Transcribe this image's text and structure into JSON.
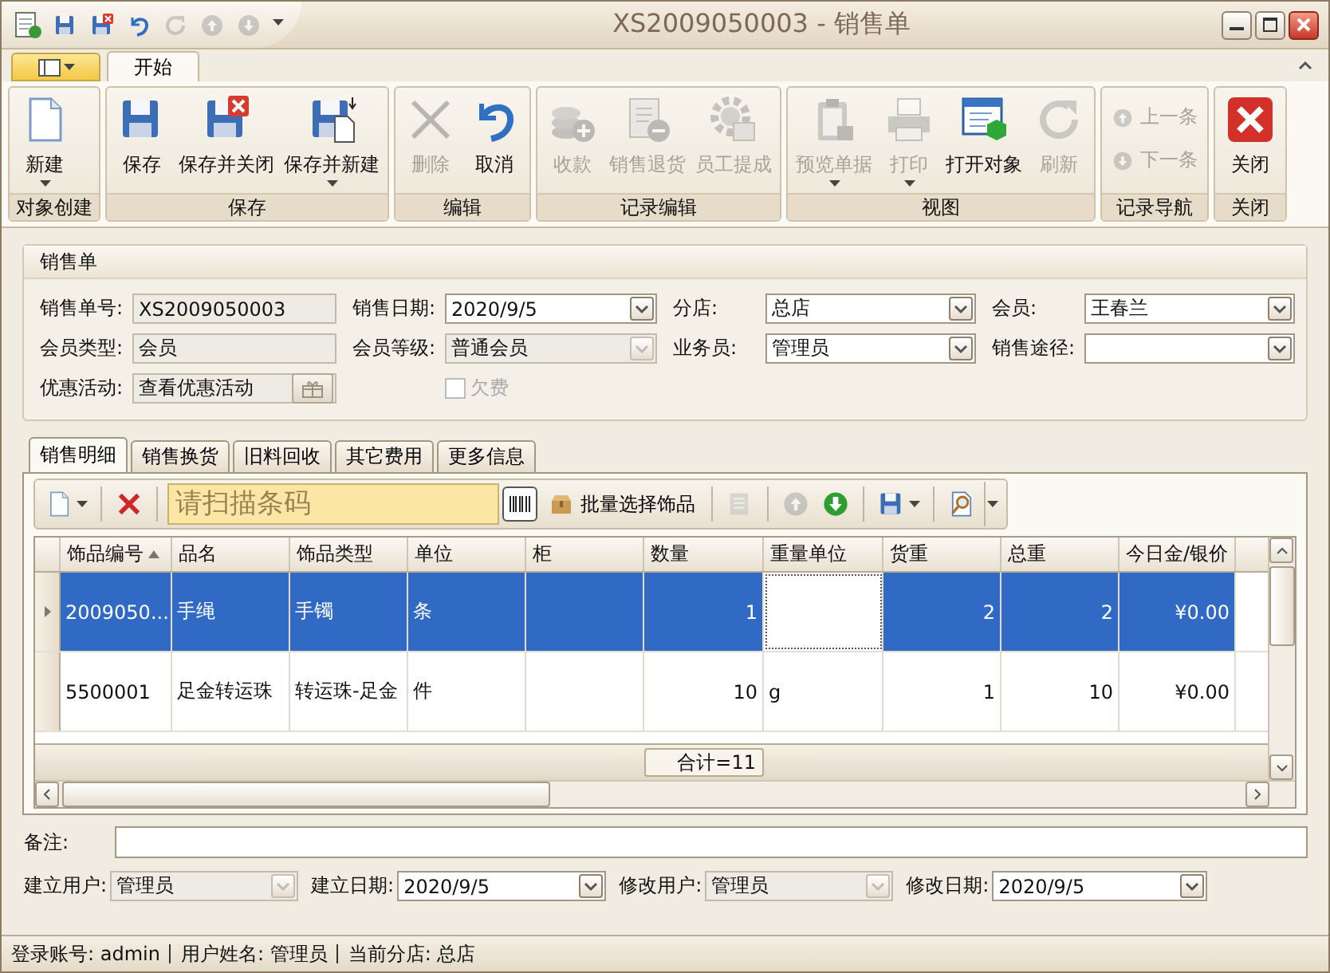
{
  "window": {
    "title": "XS2009050003 - 销售单"
  },
  "quick_access": [
    {
      "disabled": false
    },
    {
      "disabled": false
    },
    {
      "disabled": false
    },
    {
      "disabled": true
    },
    {
      "disabled": true
    },
    {
      "disabled": true
    }
  ],
  "ribbon_tabs": [
    {
      "label": "开始",
      "selected": true
    }
  ],
  "ribbon_groups": [
    {
      "label": "对象创建",
      "buttons": [
        {
          "kind": "large",
          "label": "新建",
          "disabled": false,
          "dropdown": true
        }
      ]
    },
    {
      "label": "保存",
      "buttons": [
        {
          "kind": "large",
          "label": "保存",
          "disabled": false,
          "dropdown": false
        },
        {
          "kind": "large",
          "label": "保存并关闭",
          "disabled": false,
          "dropdown": false
        },
        {
          "kind": "large",
          "label": "保存并新建",
          "disabled": false,
          "dropdown": true
        }
      ]
    },
    {
      "label": "编辑",
      "buttons": [
        {
          "kind": "large",
          "label": "删除",
          "disabled": true,
          "dropdown": false
        },
        {
          "kind": "large",
          "label": "取消",
          "disabled": false,
          "dropdown": false
        }
      ]
    },
    {
      "label": "记录编辑",
      "buttons": [
        {
          "kind": "large",
          "label": "收款",
          "disabled": true,
          "dropdown": false
        },
        {
          "kind": "large",
          "label": "销售退货",
          "disabled": true,
          "dropdown": false
        },
        {
          "kind": "large",
          "label": "员工提成",
          "disabled": true,
          "dropdown": false
        }
      ]
    },
    {
      "label": "视图",
      "buttons": [
        {
          "kind": "large",
          "label": "预览单据",
          "disabled": true,
          "dropdown": true
        },
        {
          "kind": "large",
          "label": "打印",
          "disabled": true,
          "dropdown": true
        },
        {
          "kind": "large",
          "label": "打开对象",
          "disabled": false,
          "dropdown": false
        },
        {
          "kind": "large",
          "label": "刷新",
          "disabled": true,
          "dropdown": false
        }
      ]
    },
    {
      "label": "记录导航",
      "buttons": [
        {
          "kind": "small",
          "label": "上一条",
          "disabled": true,
          "dropdown": false
        },
        {
          "kind": "small",
          "label": "下一条",
          "disabled": true,
          "dropdown": false
        }
      ]
    },
    {
      "label": "关闭",
      "buttons": [
        {
          "kind": "large",
          "label": "关闭",
          "disabled": false,
          "dropdown": false
        }
      ]
    }
  ],
  "form": {
    "title": "销售单",
    "rows": [
      [
        {
          "kind": "text",
          "label": "销售单号:",
          "value": "XS2009050003",
          "disabled": true
        },
        {
          "kind": "combo",
          "label": "销售日期:",
          "value": "2020/9/5",
          "disabled": false
        },
        {
          "kind": "combo",
          "label": "分店:",
          "value": "总店",
          "disabled": false
        },
        {
          "kind": "combo",
          "label": "会员:",
          "value": "王春兰",
          "disabled": false
        }
      ],
      [
        {
          "kind": "text",
          "label": "会员类型:",
          "value": "会员",
          "disabled": true
        },
        {
          "kind": "combo",
          "label": "会员等级:",
          "value": "普通会员",
          "disabled": true
        },
        {
          "kind": "combo",
          "label": "业务员:",
          "value": "管理员",
          "disabled": false
        },
        {
          "kind": "combo",
          "label": "销售途径:",
          "disabled": false
        }
      ],
      [
        {
          "kind": "lookup",
          "label": "优惠活动:",
          "value": "查看优惠活动",
          "disabled": true
        },
        {
          "kind": "checkbox",
          "label": "欠费",
          "checked": false,
          "disabled": true
        }
      ]
    ]
  },
  "detail_tabs": [
    {
      "label": "销售明细",
      "selected": true
    },
    {
      "label": "销售换货",
      "selected": false
    },
    {
      "label": "旧料回收",
      "selected": false
    },
    {
      "label": "其它费用",
      "selected": false
    },
    {
      "label": "更多信息",
      "selected": false
    }
  ],
  "grid_toolbar": [
    {
      "kind": "icon",
      "dropdown": true,
      "disabled": false
    },
    {
      "kind": "separator"
    },
    {
      "kind": "icon",
      "dropdown": false,
      "disabled": false
    },
    {
      "kind": "separator"
    },
    {
      "kind": "barcode",
      "placeholder": "请扫描条码"
    },
    {
      "kind": "text",
      "label": "批量选择饰品"
    },
    {
      "kind": "separator"
    },
    {
      "kind": "icon",
      "dropdown": false,
      "disabled": true
    },
    {
      "kind": "separator"
    },
    {
      "kind": "icon",
      "dropdown": false,
      "disabled": true
    },
    {
      "kind": "icon",
      "dropdown": false,
      "disabled": false
    },
    {
      "kind": "separator"
    },
    {
      "kind": "icon",
      "dropdown": true,
      "disabled": false
    },
    {
      "kind": "separator"
    },
    {
      "kind": "icon",
      "dropdown": false,
      "disabled": false
    }
  ],
  "table": {
    "columns": [
      {
        "label": "饰品编号",
        "sorted": true
      },
      {
        "label": "品名",
        "sorted": false
      },
      {
        "label": "饰品类型",
        "sorted": false
      },
      {
        "label": "单位",
        "sorted": false
      },
      {
        "label": "柜",
        "sorted": false
      },
      {
        "label": "数量",
        "sorted": false
      },
      {
        "label": "重量单位",
        "sorted": false
      },
      {
        "label": "货重",
        "sorted": false
      },
      {
        "label": "总重",
        "sorted": false
      },
      {
        "label": "今日金/银价",
        "sorted": false
      }
    ],
    "rows": [
      {
        "selected": true,
        "cells": [
          {
            "text": "2009050...",
            "focused": false
          },
          {
            "text": "手绳",
            "focused": false
          },
          {
            "text": "手镯",
            "focused": false
          },
          {
            "text": "条",
            "focused": false
          },
          {
            "focused": false
          },
          {
            "text": "1",
            "focused": false
          },
          {
            "focused": true
          },
          {
            "text": "2",
            "focused": false
          },
          {
            "text": "2",
            "focused": false
          },
          {
            "text": "¥0.00",
            "focused": false
          }
        ]
      },
      {
        "selected": false,
        "cells": [
          {
            "text": "5500001",
            "focused": false
          },
          {
            "text": "足金转运珠",
            "focused": false
          },
          {
            "text": "转运珠-足金",
            "focused": false
          },
          {
            "text": "件",
            "focused": false
          },
          {
            "focused": false
          },
          {
            "text": "10",
            "focused": false
          },
          {
            "text": "g",
            "focused": false
          },
          {
            "text": "1",
            "focused": false
          },
          {
            "text": "10",
            "focused": false
          },
          {
            "text": "¥0.00",
            "focused": false
          }
        ]
      }
    ],
    "summary": "合计=11"
  },
  "notes": {
    "label": "备注:"
  },
  "meta": [
    {
      "label": "建立用户:",
      "value": "管理员",
      "disabled": true
    },
    {
      "label": "建立日期:",
      "value": "2020/9/5",
      "disabled": false
    },
    {
      "label": "修改用户:",
      "value": "管理员",
      "disabled": true
    },
    {
      "label": "修改日期:",
      "value": "2020/9/5",
      "disabled": false
    }
  ],
  "status_bar": [
    "登录账号: admin",
    "用户姓名: 管理员",
    "当前分店: 总店"
  ]
}
